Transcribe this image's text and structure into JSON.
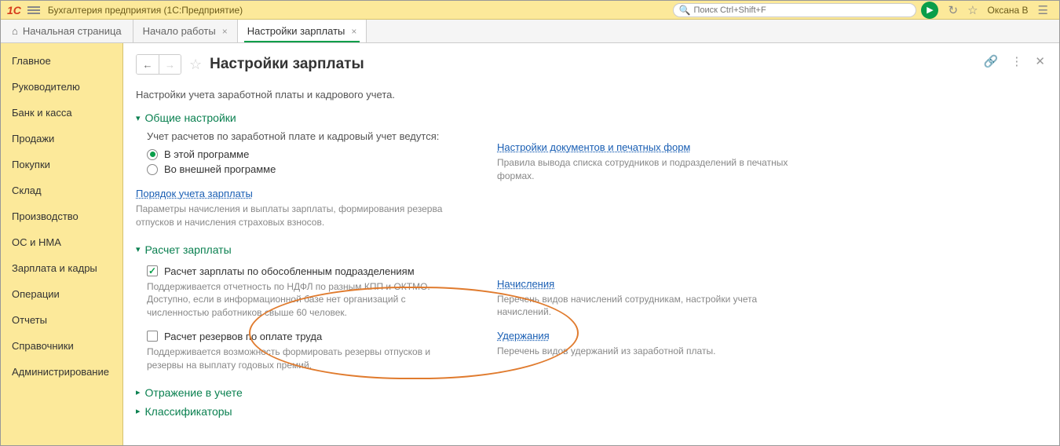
{
  "app": {
    "title": "Бухгалтерия предприятия  (1С:Предприятие)"
  },
  "search": {
    "placeholder": "Поиск Ctrl+Shift+F"
  },
  "user": {
    "name": "Оксана В"
  },
  "tabs": {
    "home": "Начальная страница",
    "items": [
      {
        "label": "Начало работы"
      },
      {
        "label": "Настройки зарплаты"
      }
    ]
  },
  "sidebar": {
    "items": [
      "Главное",
      "Руководителю",
      "Банк и касса",
      "Продажи",
      "Покупки",
      "Склад",
      "Производство",
      "ОС и НМА",
      "Зарплата и кадры",
      "Операции",
      "Отчеты",
      "Справочники",
      "Администрирование"
    ]
  },
  "page": {
    "title": "Настройки зарплаты",
    "subtitle": "Настройки учета заработной платы и кадрового учета."
  },
  "sections": {
    "general": {
      "title": "Общие настройки",
      "where_label": "Учет расчетов по заработной плате и кадровый учет ведутся:",
      "radio1": "В этой программе",
      "radio2": "Во внешней программе",
      "order_link": "Порядок учета зарплаты",
      "order_desc": "Параметры начисления и выплаты зарплаты, формирования резерва отпусков и начисления страховых взносов.",
      "docs_link": "Настройки документов и печатных форм",
      "docs_desc": "Правила вывода списка сотрудников и подразделений в печатных формах."
    },
    "salary": {
      "title": "Расчет зарплаты",
      "cb1_label": "Расчет зарплаты по обособленным подразделениям",
      "cb1_desc": "Поддерживается отчетность по НДФЛ по разным КПП и ОКТМО. Доступно, если в информационной базе нет организаций с численностью работников свыше 60 человек.",
      "cb2_label": "Расчет резервов по оплате труда",
      "cb2_desc": "Поддерживается возможность формировать резервы отпусков и резервы на выплату годовых премий.",
      "accruals_link": "Начисления",
      "accruals_desc": "Перечень видов начислений сотрудникам, настройки учета начислений.",
      "deductions_link": "Удержания",
      "deductions_desc": "Перечень видов удержаний из заработной платы."
    },
    "reflection": {
      "title": "Отражение в учете"
    },
    "classifiers": {
      "title": "Классификаторы"
    }
  }
}
